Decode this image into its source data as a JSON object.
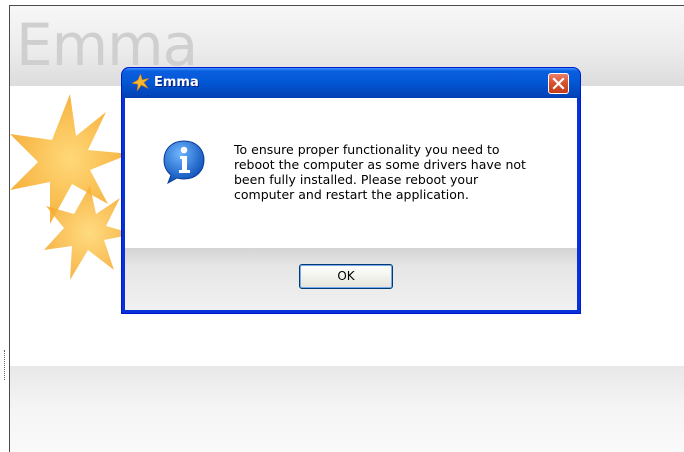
{
  "app": {
    "logo_text": "Emma"
  },
  "dialog": {
    "title": "Emma",
    "message": "To ensure proper functionality you need to\nreboot the computer as some drivers have not\nbeen fully installed. Please reboot your\ncomputer and restart the application.",
    "ok_label": "OK",
    "icons": {
      "title": "star-app-icon",
      "message": "info-icon",
      "close": "close-icon"
    }
  },
  "colors": {
    "titlebar": "#0358d6",
    "close_button": "#d8522f",
    "star": "#f7b733"
  }
}
